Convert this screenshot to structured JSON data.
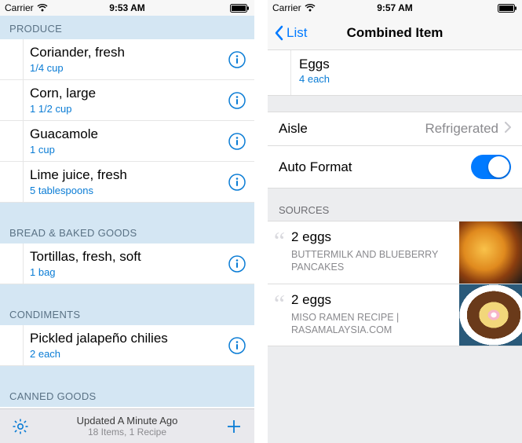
{
  "left": {
    "status": {
      "carrier": "Carrier",
      "time": "9:53 AM"
    },
    "sections": [
      {
        "header": "PRODUCE",
        "items": [
          {
            "name": "Coriander, fresh",
            "qty": "1/4 cup"
          },
          {
            "name": "Corn, large",
            "qty": "1 1/2 cup"
          },
          {
            "name": "Guacamole",
            "qty": "1 cup"
          },
          {
            "name": "Lime juice, fresh",
            "qty": "5 tablespoons"
          }
        ]
      },
      {
        "header": "BREAD & BAKED GOODS",
        "items": [
          {
            "name": "Tortillas, fresh, soft",
            "qty": "1 bag"
          }
        ]
      },
      {
        "header": "CONDIMENTS",
        "items": [
          {
            "name": "Pickled jalapeño chilies",
            "qty": "2 each"
          }
        ]
      },
      {
        "header": "CANNED GOODS",
        "items": []
      }
    ],
    "toolbar": {
      "title": "Updated A Minute Ago",
      "sub": "18 Items, 1 Recipe"
    }
  },
  "right": {
    "status": {
      "carrier": "Carrier",
      "time": "9:57 AM"
    },
    "nav": {
      "back": "List",
      "title": "Combined Item"
    },
    "item": {
      "name": "Eggs",
      "qty": "4 each"
    },
    "settings": {
      "aisle_label": "Aisle",
      "aisle_value": "Refrigerated",
      "autoformat_label": "Auto Format"
    },
    "sources": {
      "header": "SOURCES",
      "items": [
        {
          "qty": "2 eggs",
          "recipe": "BUTTERMILK AND BLUEBERRY PANCAKES"
        },
        {
          "qty": "2 eggs",
          "recipe": "MISO RAMEN RECIPE | RASAMALAYSIA.COM"
        }
      ]
    }
  }
}
